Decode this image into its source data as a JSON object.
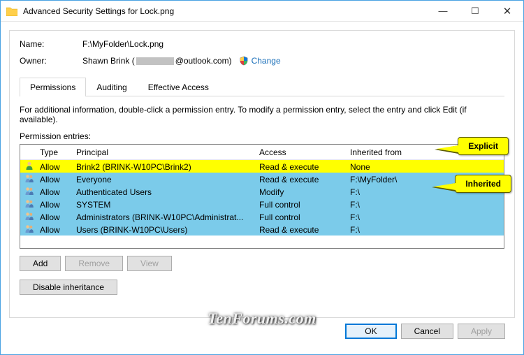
{
  "window": {
    "title": "Advanced Security Settings for Lock.png"
  },
  "fields": {
    "name_label": "Name:",
    "name_value": "F:\\MyFolder\\Lock.png",
    "owner_label": "Owner:",
    "owner_value_prefix": "Shawn Brink (",
    "owner_value_suffix": "@outlook.com)",
    "change_label": "Change"
  },
  "tabs": {
    "permissions": "Permissions",
    "auditing": "Auditing",
    "effective": "Effective Access"
  },
  "info": "For additional information, double-click a permission entry. To modify a permission entry, select the entry and click Edit (if available).",
  "entries_label": "Permission entries:",
  "headers": {
    "type": "Type",
    "principal": "Principal",
    "access": "Access",
    "inherited": "Inherited from"
  },
  "rows": [
    {
      "type": "Allow",
      "principal": "Brink2 (BRINK-W10PC\\Brink2)",
      "access": "Read & execute",
      "inherited": "None",
      "hl": "yellow",
      "icon": "single"
    },
    {
      "type": "Allow",
      "principal": "Everyone",
      "access": "Read & execute",
      "inherited": "F:\\MyFolder\\",
      "hl": "blue",
      "icon": "group"
    },
    {
      "type": "Allow",
      "principal": "Authenticated Users",
      "access": "Modify",
      "inherited": "F:\\",
      "hl": "blue",
      "icon": "group"
    },
    {
      "type": "Allow",
      "principal": "SYSTEM",
      "access": "Full control",
      "inherited": "F:\\",
      "hl": "blue",
      "icon": "group"
    },
    {
      "type": "Allow",
      "principal": "Administrators (BRINK-W10PC\\Administrat...",
      "access": "Full control",
      "inherited": "F:\\",
      "hl": "blue",
      "icon": "group"
    },
    {
      "type": "Allow",
      "principal": "Users (BRINK-W10PC\\Users)",
      "access": "Read & execute",
      "inherited": "F:\\",
      "hl": "blue",
      "icon": "group"
    }
  ],
  "buttons": {
    "add": "Add",
    "remove": "Remove",
    "view": "View",
    "disable": "Disable inheritance",
    "ok": "OK",
    "cancel": "Cancel",
    "apply": "Apply"
  },
  "callouts": {
    "explicit": "Explicit",
    "inherited": "Inherited"
  },
  "watermark": "TenForums.com"
}
